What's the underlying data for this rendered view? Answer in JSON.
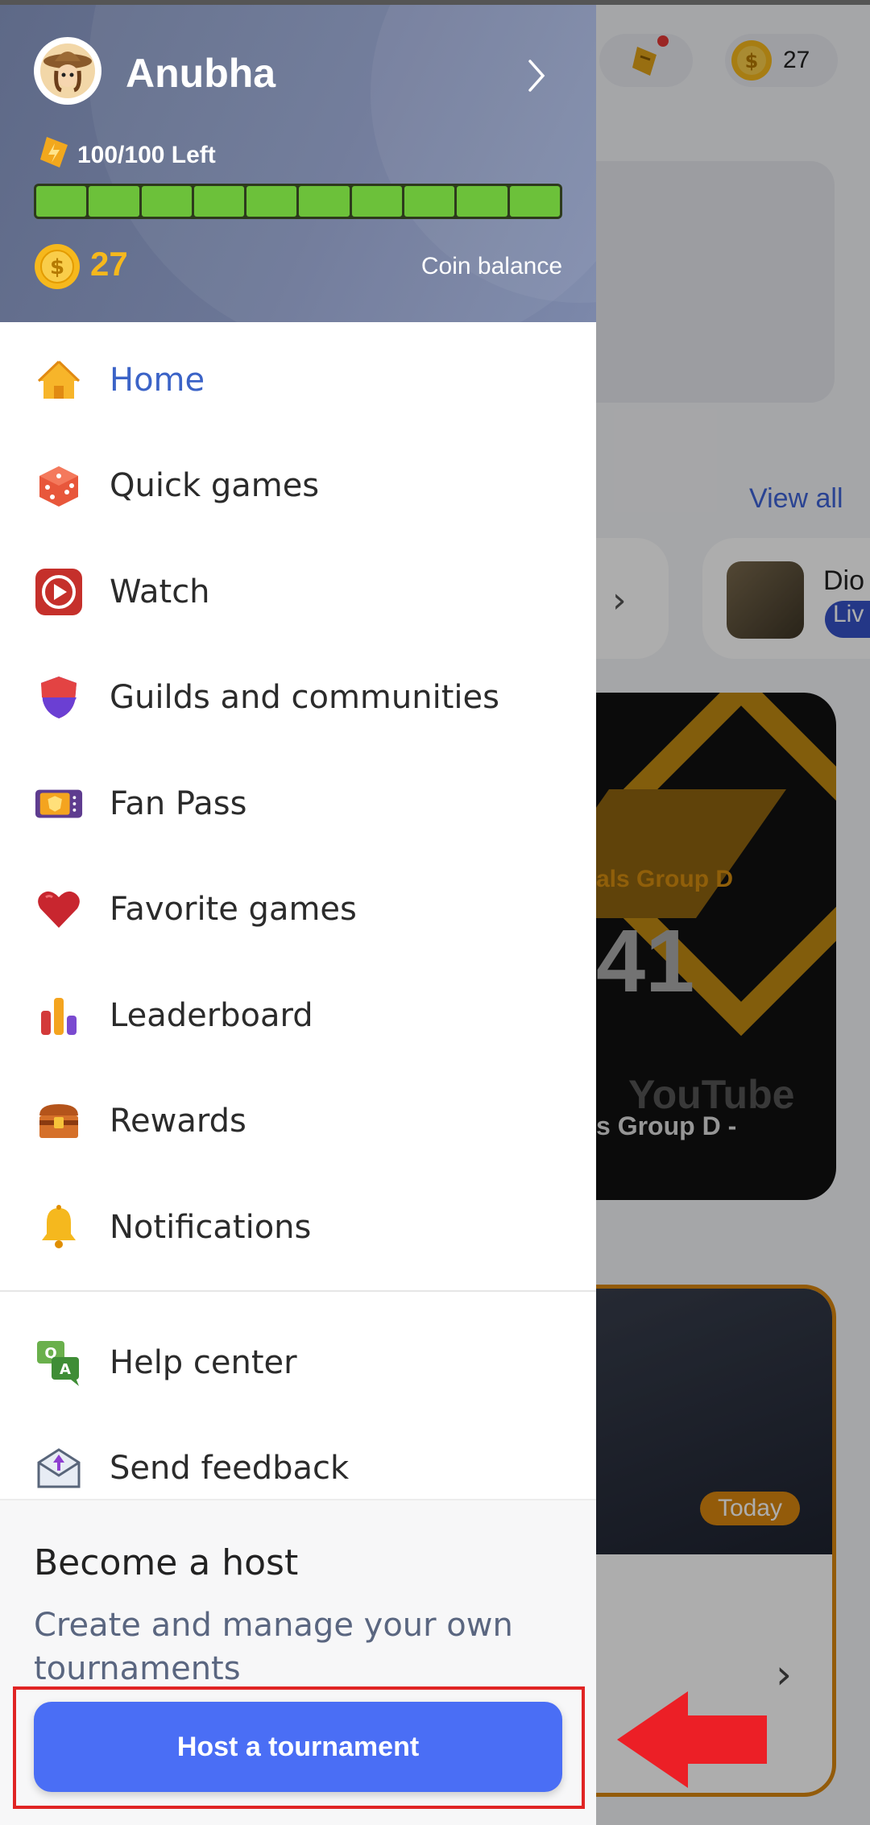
{
  "background": {
    "coin_count": "27",
    "view_all": "View all",
    "chip_name": "Dio",
    "chip_badge": "Liv",
    "video_line1": "als Group D",
    "video_number": "41",
    "video_brand": "YouTube",
    "video_line2": "s Group D -",
    "card_badge": "Today"
  },
  "profile": {
    "username": "Anubha",
    "energy_text": "100/100 Left",
    "energy_fraction": 1.0,
    "energy_segments": 10,
    "coin_balance": "27",
    "coin_label": "Coin balance"
  },
  "menu": {
    "items": [
      {
        "label": "Home",
        "icon": "home-icon",
        "active": true
      },
      {
        "label": "Quick games",
        "icon": "dice-icon"
      },
      {
        "label": "Watch",
        "icon": "play-icon"
      },
      {
        "label": "Guilds and communities",
        "icon": "shield-icon"
      },
      {
        "label": "Fan Pass",
        "icon": "ticket-icon"
      },
      {
        "label": "Favorite games",
        "icon": "heart-icon"
      },
      {
        "label": "Leaderboard",
        "icon": "leaderboard-icon"
      },
      {
        "label": "Rewards",
        "icon": "treasure-chest-icon"
      },
      {
        "label": "Notifications",
        "icon": "bell-icon"
      }
    ],
    "secondary": [
      {
        "label": "Help center",
        "icon": "qa-chat-icon"
      },
      {
        "label": "Send feedback",
        "icon": "envelope-icon"
      }
    ]
  },
  "host": {
    "title": "Become a host",
    "description": "Create and manage your own tournaments",
    "button_label": "Host a tournament"
  },
  "colors": {
    "accent": "#4a6ef5",
    "active_text": "#3b63c7",
    "coin": "#f6b81c",
    "energy": "#6cc13a",
    "annotation": "#e02424"
  }
}
